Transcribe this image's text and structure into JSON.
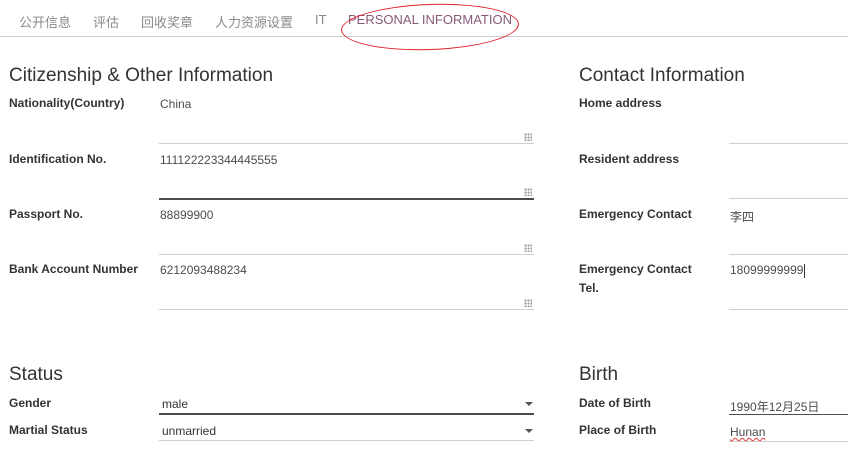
{
  "tabs": [
    {
      "label": "公开信息"
    },
    {
      "label": "评估"
    },
    {
      "label": "回收奖章"
    },
    {
      "label": "人力资源设置"
    },
    {
      "label": "IT"
    },
    {
      "label": "PERSONAL INFORMATION"
    }
  ],
  "active_tab": "PERSONAL INFORMATION",
  "citizenship": {
    "title": "Citizenship & Other Information",
    "nationality_label": "Nationality(Country)",
    "nationality_value": "China",
    "id_label": "Identification No.",
    "id_value": "111122223344445555",
    "passport_label": "Passport No.",
    "passport_value": "88899900",
    "bank_label": "Bank Account Number",
    "bank_value": "6212093488234"
  },
  "contact": {
    "title": "Contact Information",
    "home_label": "Home address",
    "home_value": "",
    "resident_label": "Resident address",
    "resident_value": "",
    "emergency_label": "Emergency Contact",
    "emergency_value": "李四",
    "tel_label": "Emergency Contact Tel.",
    "tel_value": "18099999999"
  },
  "status": {
    "title": "Status",
    "gender_label": "Gender",
    "gender_value": "male",
    "marital_label": "Martial Status",
    "marital_value": "unmarried"
  },
  "birth": {
    "title": "Birth",
    "dob_label": "Date of Birth",
    "dob_value": "1990年12月25日",
    "place_label": "Place of Birth",
    "place_value": "Hunan"
  },
  "colors": {
    "active_tab": "#875a7b",
    "annotation_circle": "#e0242b"
  }
}
